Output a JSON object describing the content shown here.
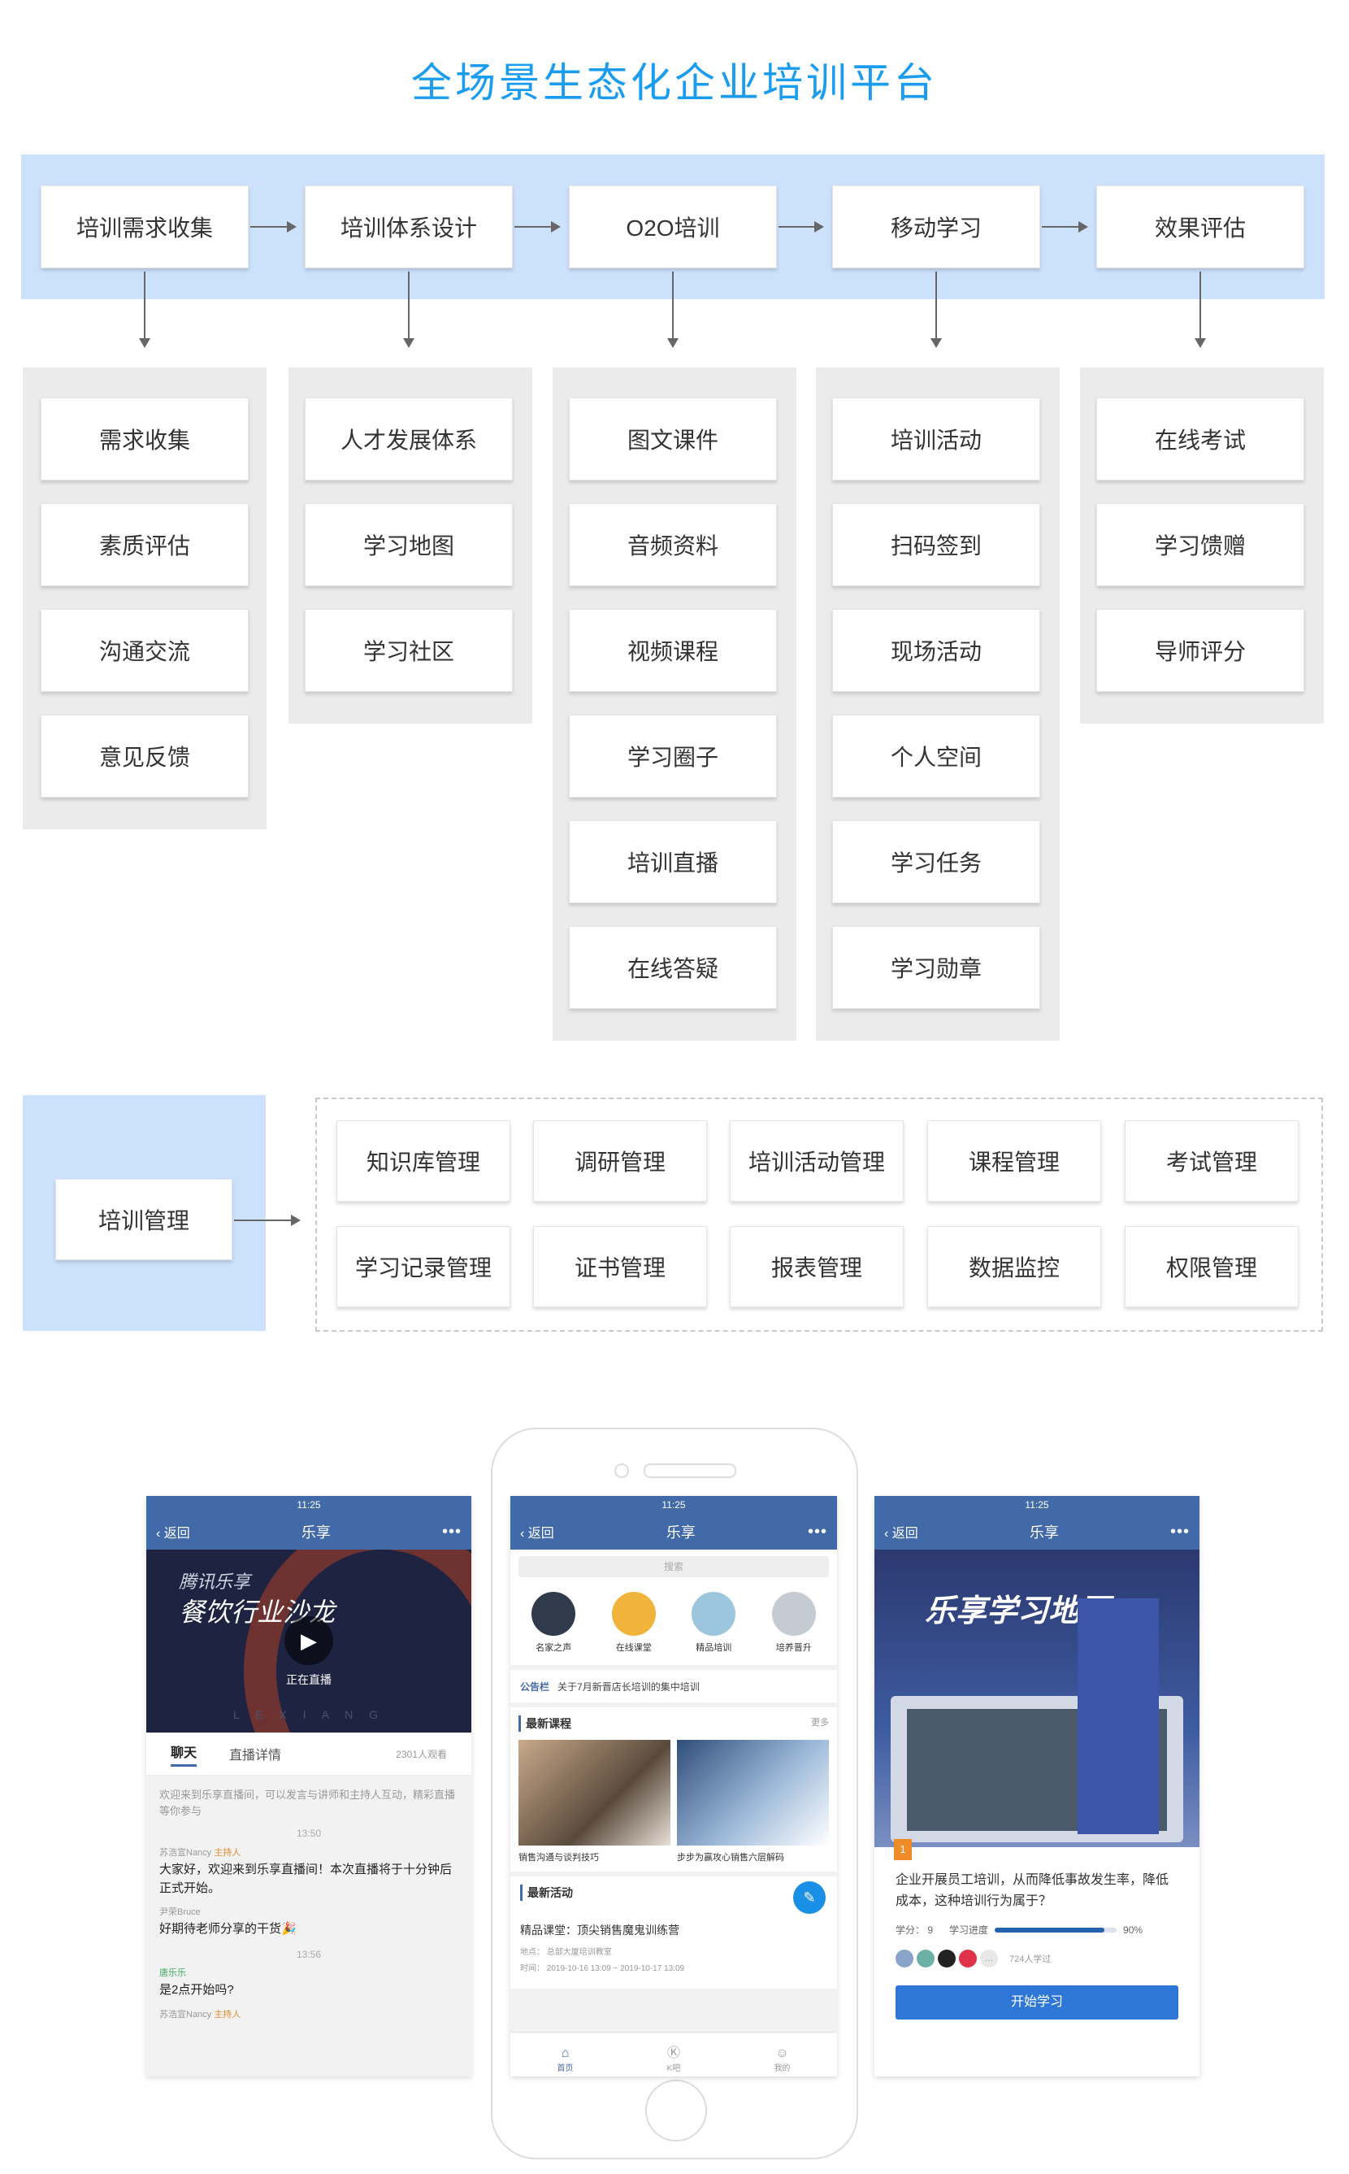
{
  "title": "全场景生态化企业培训平台",
  "flow": [
    {
      "label": "培训需求收集",
      "items": [
        "需求收集",
        "素质评估",
        "沟通交流",
        "意见反馈"
      ]
    },
    {
      "label": "培训体系设计",
      "items": [
        "人才发展体系",
        "学习地图",
        "学习社区"
      ]
    },
    {
      "label": "O2O培训",
      "items": [
        "图文课件",
        "音频资料",
        "视频课程",
        "学习圈子",
        "培训直播",
        "在线答疑"
      ]
    },
    {
      "label": "移动学习",
      "items": [
        "培训活动",
        "扫码签到",
        "现场活动",
        "个人空间",
        "学习任务",
        "学习勋章"
      ]
    },
    {
      "label": "效果评估",
      "items": [
        "在线考试",
        "学习馈赠",
        "导师评分"
      ]
    }
  ],
  "management": {
    "label": "培训管理",
    "items": [
      "知识库管理",
      "调研管理",
      "培训活动管理",
      "课程管理",
      "考试管理",
      "学习记录管理",
      "证书管理",
      "报表管理",
      "数据监控",
      "权限管理"
    ]
  },
  "phones": {
    "time": "11:25",
    "back": "返回",
    "app_title": "乐享",
    "more": "•••",
    "live": {
      "banner_brand": "腾讯乐享",
      "banner_title": "餐饮行业沙龙",
      "live_status": "正在直播",
      "watermark": "L E X I A N G",
      "tab_chat": "聊天",
      "tab_detail": "直播详情",
      "viewers": "2301人观看",
      "welcome": "欢迎来到乐享直播间，可以发言与讲师和主持人互动，精彩直播等你参与",
      "messages": [
        {
          "time": "13:50",
          "name": "苏浩宣Nancy",
          "role": "主持人",
          "text": "大家好，欢迎来到乐享直播间！本次直播将于十分钟后正式开始。"
        },
        {
          "time": "",
          "name": "尹荣Bruce",
          "role": "",
          "text": "好期待老师分享的干货🎉"
        },
        {
          "time": "13:56",
          "name": "唐乐乐",
          "role": "",
          "text": "是2点开始吗?"
        },
        {
          "time": "",
          "name": "苏浩宣Nancy",
          "role": "主持人",
          "text": ""
        }
      ]
    },
    "home": {
      "search": "搜索",
      "icons": [
        "名家之声",
        "在线课堂",
        "精品培训",
        "培养晋升"
      ],
      "notice_tag": "公告栏",
      "notice_text": "关于7月新晋店长培训的集中培训",
      "latest_course": "最新课程",
      "more": "更多",
      "courses": [
        "销售沟通与谈判技巧",
        "步步为赢攻心销售六层解码"
      ],
      "latest_activity": "最新活动",
      "activity_title": "精品课堂：顶尖销售魔鬼训练营",
      "activity_place": "地点：  总部大厦培训教室",
      "activity_time": "时间：  2019-10-16 13:09 ~ 2019-10-17 13:09",
      "tabbar": [
        "首页",
        "K吧",
        "我的"
      ]
    },
    "map": {
      "banner_title": "乐享学习地图",
      "step": "1",
      "question": "企业开展员工培训，从而降低事故发生率，降低成本，这种培训行为属于？",
      "credits": "学分：  9",
      "progress_label": "学习进度",
      "progress_value": "90%",
      "progress": 0.9,
      "learners": "724人学过",
      "start": "开始学习"
    }
  }
}
